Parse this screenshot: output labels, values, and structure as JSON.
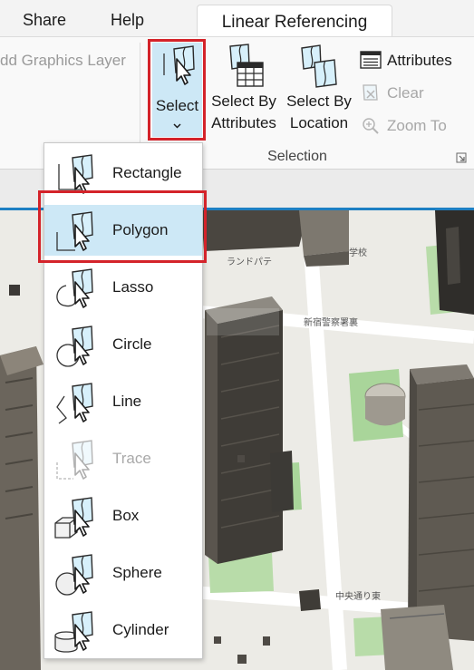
{
  "menubar": {
    "share": "Share",
    "help": "Help",
    "active_tab": "Linear Referencing"
  },
  "ribbon": {
    "add_graphics_layer": "dd Graphics Layer",
    "select": {
      "label": "Select"
    },
    "select_by_attributes": {
      "line1": "Select By",
      "line2": "Attributes"
    },
    "select_by_location": {
      "line1": "Select By",
      "line2": "Location"
    },
    "attributes": "Attributes",
    "clear": "Clear",
    "zoom_to": "Zoom To",
    "group_label": "Selection"
  },
  "select_menu": {
    "items": [
      {
        "label": "Rectangle",
        "icon": "rectangle-select-icon",
        "enabled": true
      },
      {
        "label": "Polygon",
        "icon": "polygon-select-icon",
        "enabled": true,
        "active": true
      },
      {
        "label": "Lasso",
        "icon": "lasso-select-icon",
        "enabled": true
      },
      {
        "label": "Circle",
        "icon": "circle-select-icon",
        "enabled": true
      },
      {
        "label": "Line",
        "icon": "line-select-icon",
        "enabled": true
      },
      {
        "label": "Trace",
        "icon": "trace-select-icon",
        "enabled": false
      },
      {
        "label": "Box",
        "icon": "box-select-icon",
        "enabled": true
      },
      {
        "label": "Sphere",
        "icon": "sphere-select-icon",
        "enabled": true
      },
      {
        "label": "Cylinder",
        "icon": "cylinder-select-icon",
        "enabled": true
      }
    ]
  },
  "map": {
    "labels": [
      "ランドパテ",
      "新宿警察署裏",
      "学校",
      "中央通り東"
    ]
  },
  "colors": {
    "highlight_border": "#d4232a",
    "selected_bg": "#cde8f6",
    "accent_blue": "#1d7fc3"
  }
}
